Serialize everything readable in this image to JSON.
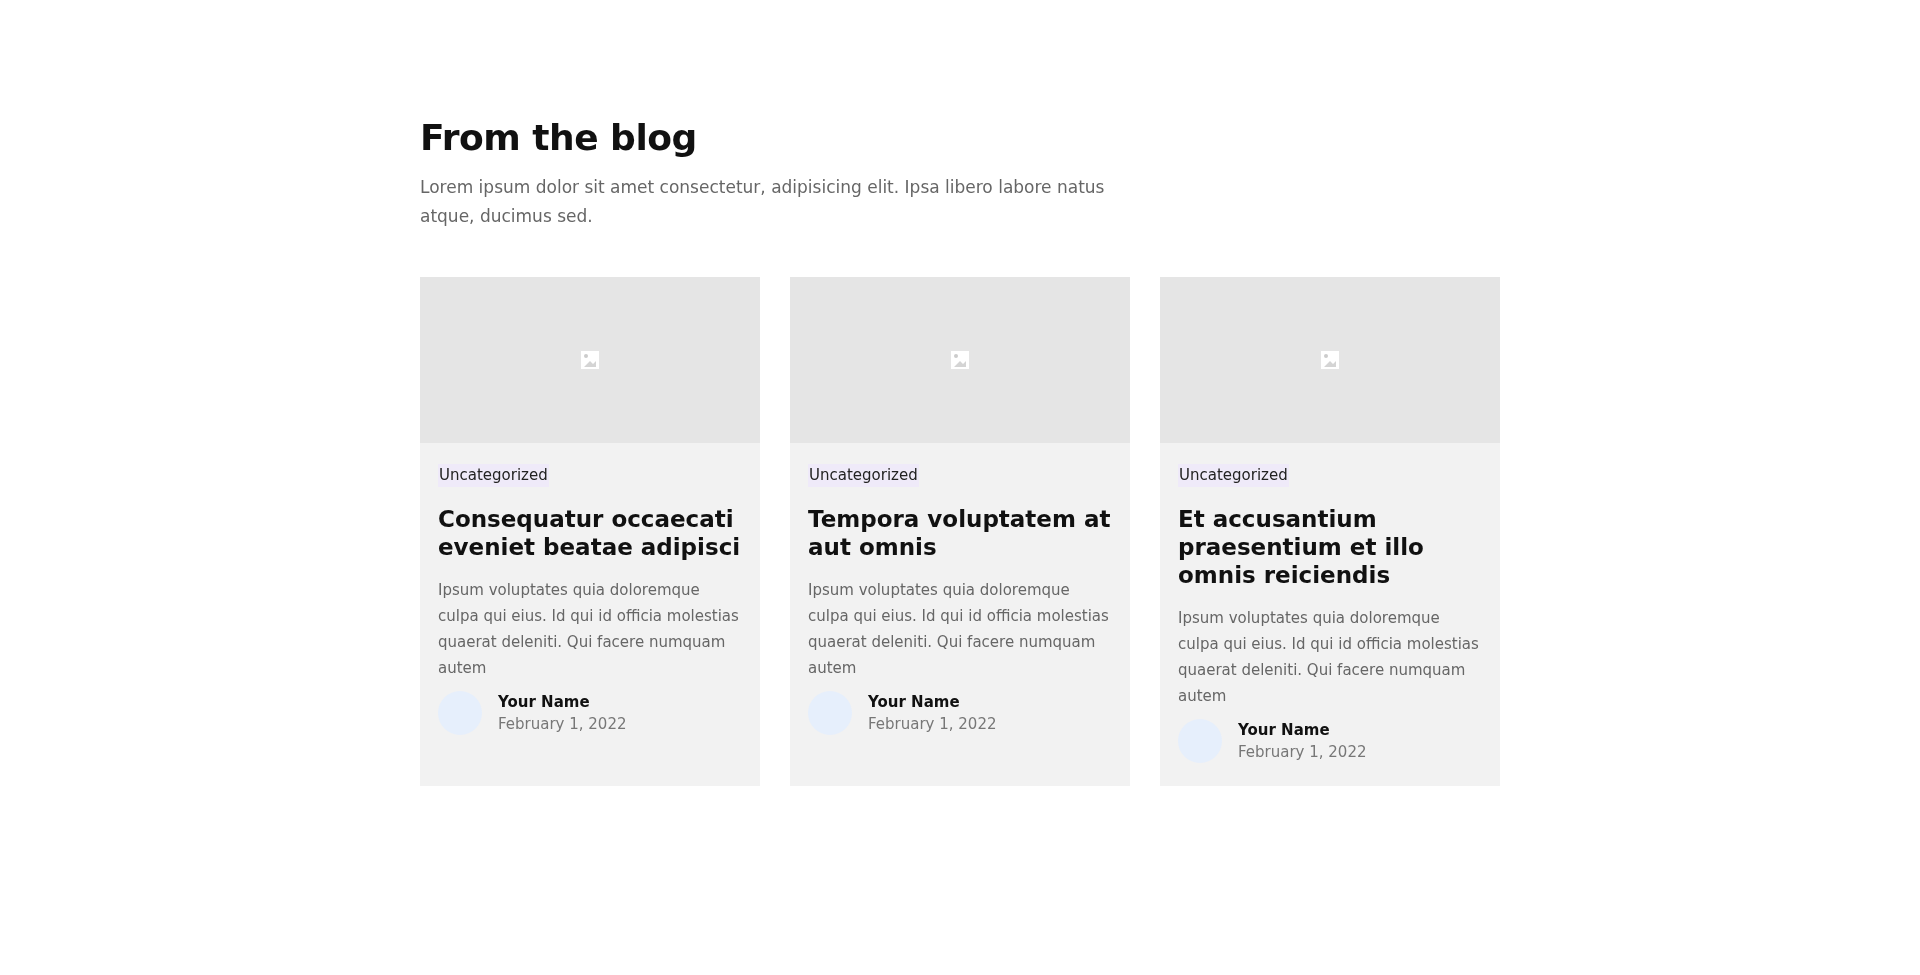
{
  "section": {
    "title": "From the blog",
    "intro": "Lorem ipsum dolor sit amet consectetur, adipisicing elit. Ipsa libero labore natus atque, ducimus sed."
  },
  "posts": [
    {
      "category": "Uncategorized",
      "title": "Consequatur occaecati eveniet beatae adipisci",
      "excerpt": "Ipsum voluptates quia doloremque culpa qui eius. Id qui id officia molestias quaerat deleniti. Qui facere numquam autem",
      "author": "Your Name",
      "date": "February 1, 2022"
    },
    {
      "category": "Uncategorized",
      "title": "Tempora voluptatem at aut omnis",
      "excerpt": "Ipsum voluptates quia doloremque culpa qui eius. Id qui id officia molestias quaerat deleniti. Qui facere numquam autem",
      "author": "Your Name",
      "date": "February 1, 2022"
    },
    {
      "category": "Uncategorized",
      "title": "Et accusantium praesentium et illo omnis reiciendis",
      "excerpt": "Ipsum voluptates quia doloremque culpa qui eius. Id qui id officia molestias quaerat deleniti. Qui facere numquam autem",
      "author": "Your Name",
      "date": "February 1, 2022"
    }
  ]
}
